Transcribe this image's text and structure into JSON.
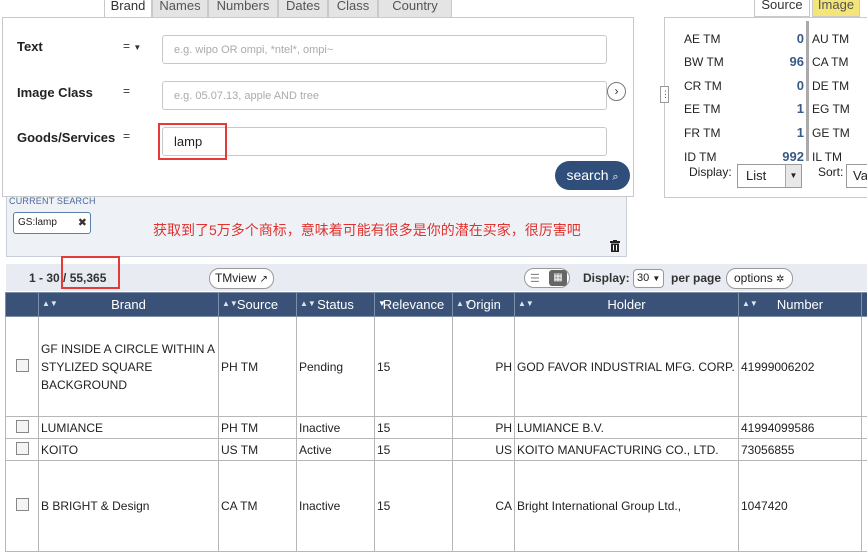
{
  "tabs": [
    "Brand",
    "Names",
    "Numbers",
    "Dates",
    "Class",
    "Country"
  ],
  "fields": [
    {
      "label": "Text",
      "op": "=",
      "placeholder": "e.g. wipo OR ompi, *ntel*, ompi~",
      "value": ""
    },
    {
      "label": "Image Class",
      "op": "=",
      "placeholder": "e.g. 05.07.13, apple AND tree",
      "value": ""
    },
    {
      "label": "Goods/Services",
      "op": "=",
      "placeholder": "",
      "value": "lamp"
    }
  ],
  "search_label": "search",
  "current_search": {
    "title": "CURRENT SEARCH",
    "chip": "GS:lamp"
  },
  "annotation": "获取到了5万多个商标，意味着可能有很多是你的潜在买家，很厉害吧",
  "right_panel": {
    "tabs": [
      "Source",
      "Image"
    ],
    "rows": [
      {
        "code": "AE TM",
        "count": "0",
        "right": "AU TM"
      },
      {
        "code": "BW TM",
        "count": "96",
        "right": "CA TM"
      },
      {
        "code": "CR TM",
        "count": "0",
        "right": "DE TM"
      },
      {
        "code": "EE TM",
        "count": "1",
        "right": "EG TM"
      },
      {
        "code": "FR TM",
        "count": "1",
        "right": "GE TM"
      },
      {
        "code": "ID TM",
        "count": "992",
        "right": "IL TM"
      }
    ],
    "display_label": "Display:",
    "display_value": "List",
    "sort_label": "Sort:",
    "sort_value": "Va"
  },
  "results": {
    "range": "1 - 30 / 55,365",
    "tmview": "TMview",
    "display_label": "Display:",
    "per_page_value": "30",
    "per_page_label": "per page",
    "options": "options"
  },
  "table": {
    "headers": [
      "Brand",
      "Source",
      "Status",
      "Relevance",
      "Origin",
      "Holder",
      "Number"
    ],
    "rows": [
      {
        "brand": "GF INSIDE A CIRCLE WITHIN A STYLIZED SQUARE BACKGROUND",
        "source": "PH TM",
        "status": "Pending",
        "relevance": "15",
        "origin": "PH",
        "holder": "GOD FAVOR INDUSTRIAL MFG. CORP.",
        "number": "41999006202"
      },
      {
        "brand": "LUMIANCE",
        "source": "PH TM",
        "status": "Inactive",
        "relevance": "15",
        "origin": "PH",
        "holder": "LUMIANCE B.V.",
        "number": "41994099586"
      },
      {
        "brand": "KOITO",
        "source": "US TM",
        "status": "Active",
        "relevance": "15",
        "origin": "US",
        "holder": "KOITO MANUFACTURING CO., LTD.",
        "number": "73056855"
      },
      {
        "brand": "B BRIGHT & Design",
        "source": "CA TM",
        "status": "Inactive",
        "relevance": "15",
        "origin": "CA",
        "holder": "Bright International Group Ltd.,",
        "number": "1047420"
      }
    ]
  }
}
